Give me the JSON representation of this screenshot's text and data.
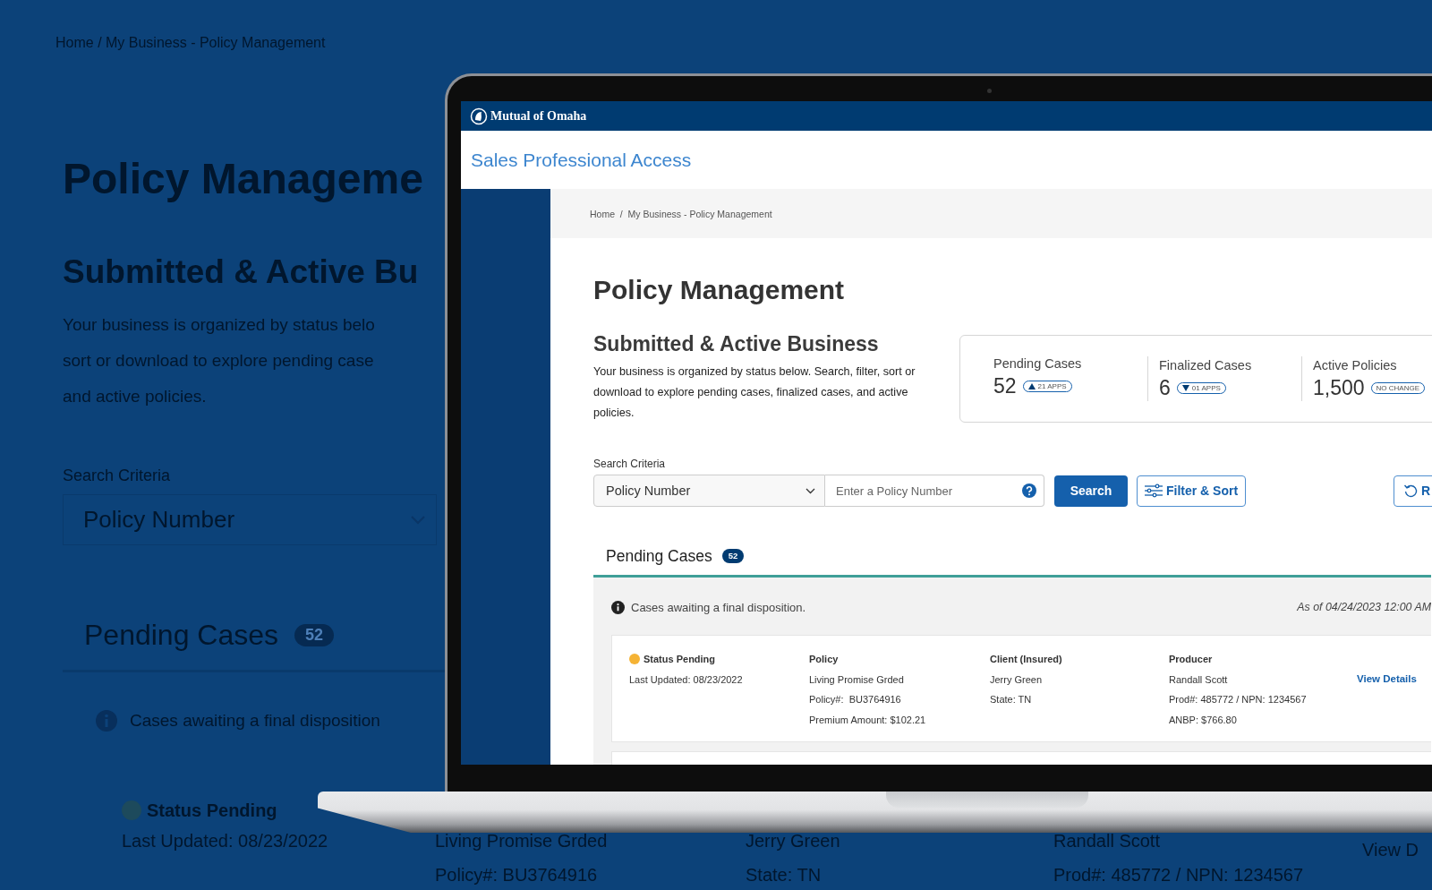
{
  "backdrop": {
    "breadcrumb": "Home / My Business - Policy Management",
    "title": "Policy Manageme",
    "subtitle": "Submitted & Active Bu",
    "description_lines": [
      "Your business is organized by status belo",
      "sort or download to explore pending case",
      "and active policies."
    ],
    "search_label": "Search Criteria",
    "search_criteria": "Policy Number",
    "tab": {
      "label": "Pending Cases",
      "count": "52",
      "selected": true
    },
    "info": "Cases awaiting a final disposition",
    "case": {
      "status": "Status Pending",
      "color": "#1d4a5c",
      "last_updated": "Last Updated: 08/23/2022",
      "columns": [
        [
          "Living Promise Grded",
          "Policy#: BU3764916"
        ],
        [
          "Jerry Green",
          "State: TN"
        ],
        [
          "Randall Scott",
          "Prod#: 485772 / NPN: 1234567"
        ]
      ],
      "link": "View D"
    }
  },
  "header": {
    "logo": "Mutual of Omaha"
  },
  "app_title": "Sales Professional Access",
  "breadcrumb": "Home  /  My Business - Policy Management",
  "page_title": "Policy Management",
  "section_title": "Submitted & Active Business",
  "description": "Your business is organized by status below. Search, filter, sort or download to explore pending cases, finalized cases, and active policies.",
  "stats": [
    {
      "label": "Pending Cases",
      "value": "52",
      "badge": "21 APPS",
      "kind": "up"
    },
    {
      "label": "Finalized Cases",
      "value": "6",
      "badge": "01 APPS",
      "kind": "down"
    },
    {
      "label": "Active Policies",
      "value": "1,500",
      "badge": "NO CHANGE",
      "kind": "none"
    }
  ],
  "search": {
    "label": "Search Criteria",
    "criteria": "Policy Number",
    "placeholder": "Enter a Policy Number",
    "button": "Search",
    "filter_button": "Filter & Sort",
    "reset_button": "R"
  },
  "tabs": [
    {
      "label": "Pending Cases",
      "count": "52",
      "selected": true
    }
  ],
  "panel": {
    "info": "Cases awaiting a final disposition.",
    "as_of": "As of 04/24/2023 12:00 AM"
  },
  "cases": [
    {
      "status": "Status Pending",
      "color": "#f5b335",
      "last_updated": "Last Updated: 08/23/2022",
      "columns": [
        {
          "heading": "Policy",
          "lines": [
            "Living Promise Grded",
            "Policy#:  BU3764916",
            "Premium Amount: $102.21"
          ]
        },
        {
          "heading": "Client (Insured)",
          "lines": [
            "Jerry Green",
            "State: TN"
          ]
        },
        {
          "heading": "Producer",
          "lines": [
            "Randall Scott",
            "Prod#: 485772 / NPN: 1234567",
            "ANBP: $766.80"
          ]
        }
      ],
      "link": "View Details"
    }
  ]
}
